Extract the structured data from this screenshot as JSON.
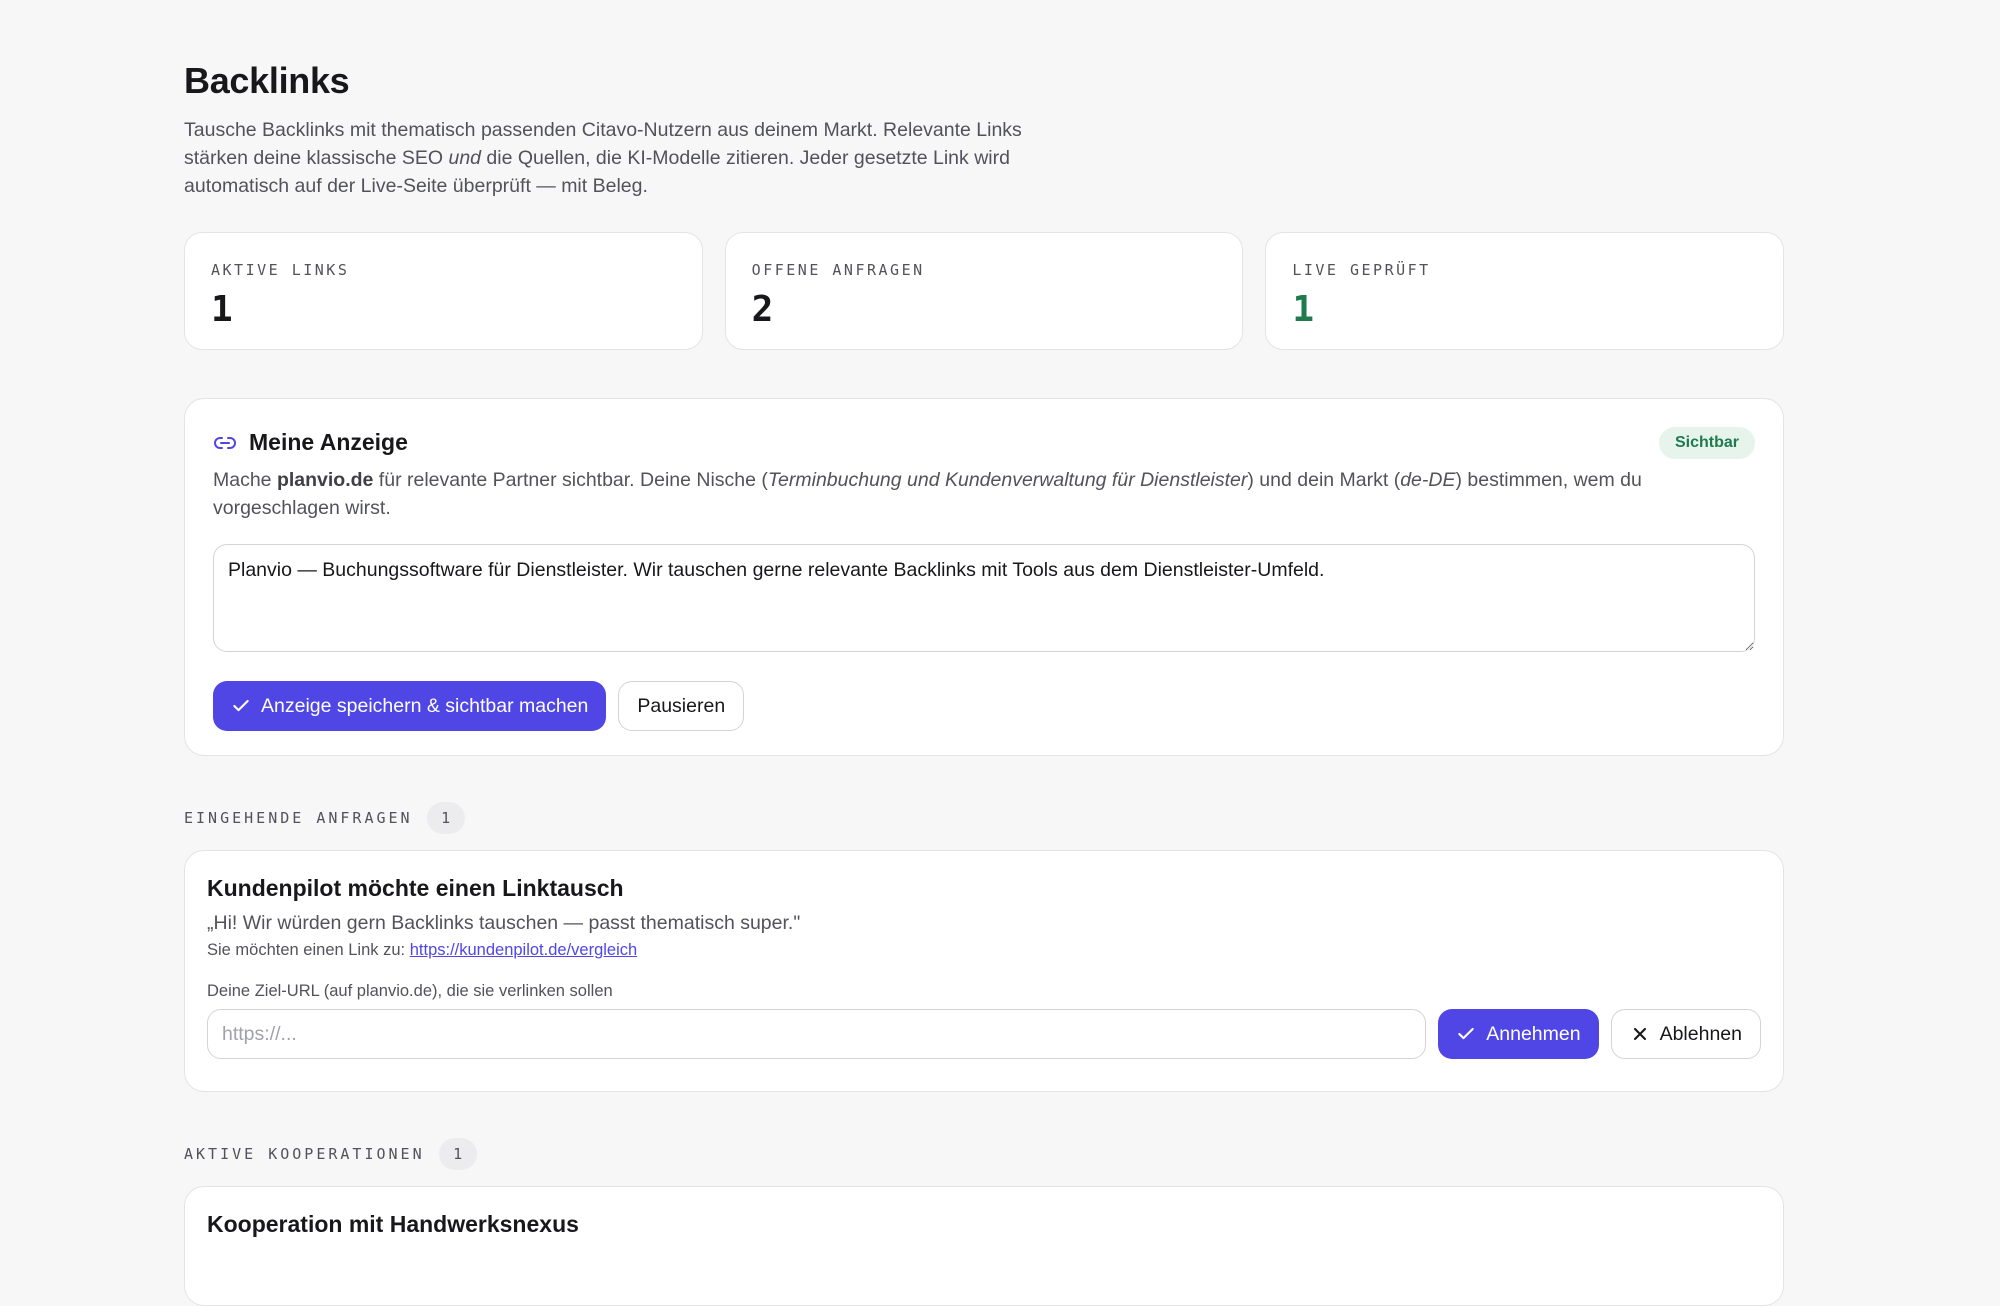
{
  "page": {
    "title": "Backlinks",
    "lead_part1": "Tausche Backlinks mit thematisch passenden Citavo-Nutzern aus deinem Markt. Relevante Links stärken deine klassische SEO ",
    "lead_em": "und",
    "lead_part2": " die Quellen, die KI-Modelle zitieren. Jeder gesetzte Link wird automatisch auf der Live-Seite überprüft — mit Beleg."
  },
  "stats": [
    {
      "label": "AKTIVE LINKS",
      "value": "1",
      "color": "#18181b"
    },
    {
      "label": "OFFENE ANFRAGEN",
      "value": "2",
      "color": "#18181b"
    },
    {
      "label": "LIVE GEPRÜFT",
      "value": "1",
      "color": "#1f7a4d"
    }
  ],
  "ad": {
    "icon": "link-icon",
    "title": "Meine Anzeige",
    "status": "Sichtbar",
    "desc_prefix": "Mache ",
    "domain": "planvio.de",
    "desc_mid1": " für relevante Partner sichtbar. Deine Nische (",
    "niche": "Terminbuchung und Kundenverwaltung für Dienstleister",
    "desc_mid2": ") und dein Markt (",
    "market": "de-DE",
    "desc_suffix": ") bestimmen, wem du vorgeschlagen wirst.",
    "text_value": "Planvio — Buchungssoftware für Dienstleister. Wir tauschen gerne relevante Backlinks mit Tools aus dem Dienstleister-Umfeld.",
    "save_label": "Anzeige speichern & sichtbar machen",
    "pause_label": "Pausieren"
  },
  "incoming": {
    "section_label": "EINGEHENDE ANFRAGEN",
    "count": "1",
    "title": "Kundenpilot möchte einen Linktausch",
    "quote": "„Hi! Wir würden gern Backlinks tauschen — passt thematisch super.\"",
    "link_prefix": "Sie möchten einen Link zu: ",
    "link_url": "https://kundenpilot.de/vergleich",
    "field_label": "Deine Ziel-URL (auf planvio.de), die sie verlinken sollen",
    "field_placeholder": "https://...",
    "accept_label": "Annehmen",
    "decline_label": "Ablehnen"
  },
  "active": {
    "section_label": "AKTIVE KOOPERATIONEN",
    "count": "1",
    "title": "Kooperation mit Handwerksnexus"
  }
}
